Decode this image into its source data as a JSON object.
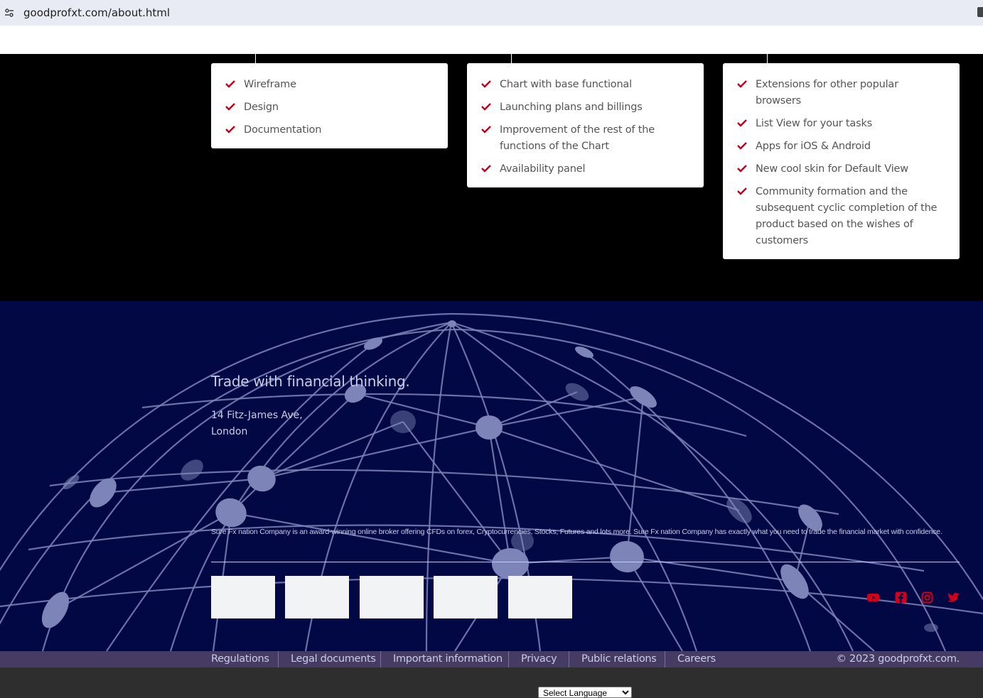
{
  "browser": {
    "url": "goodprofxt.com/about.html"
  },
  "roadmap": {
    "columns": [
      {
        "items": [
          "Wireframe",
          "Design",
          "Documentation"
        ]
      },
      {
        "items": [
          "Chart with base functional",
          "Launching plans and billings",
          "Improvement of the rest of the functions of the Chart",
          "Availability panel"
        ]
      },
      {
        "items": [
          "Extensions for other popular browsers",
          "List View for your tasks",
          "Apps for iOS & Android",
          "New cool skin for Default View",
          "Community formation and the subsequent cyclic completion of the product based on the wishes of customers"
        ]
      }
    ],
    "check_color": "#c0001a"
  },
  "footer": {
    "tagline": "Trade with financial thinking.",
    "address_line1": "14 Fitz-James Ave,",
    "address_line2": "London",
    "disclaimer": "Sure Fx nation Company is an award-winning online broker offering CFDs on forex, Cryptocurrencies, Stocks, Futures and lots more. Sure Fx nation Company has exactly what you need to trade the financial market with confidence.",
    "social_icons": [
      "youtube-icon",
      "facebook-icon",
      "instagram-icon",
      "twitter-icon"
    ],
    "social_color": "#d0001c",
    "background": "#020844"
  },
  "bottom_nav": {
    "links": [
      "Regulations",
      "Legal documents",
      "Important information",
      "Privacy",
      "Public relations",
      "Careers"
    ],
    "copyright": "© 2023 goodprofxt.com."
  },
  "language": {
    "selected": "Select Language"
  }
}
